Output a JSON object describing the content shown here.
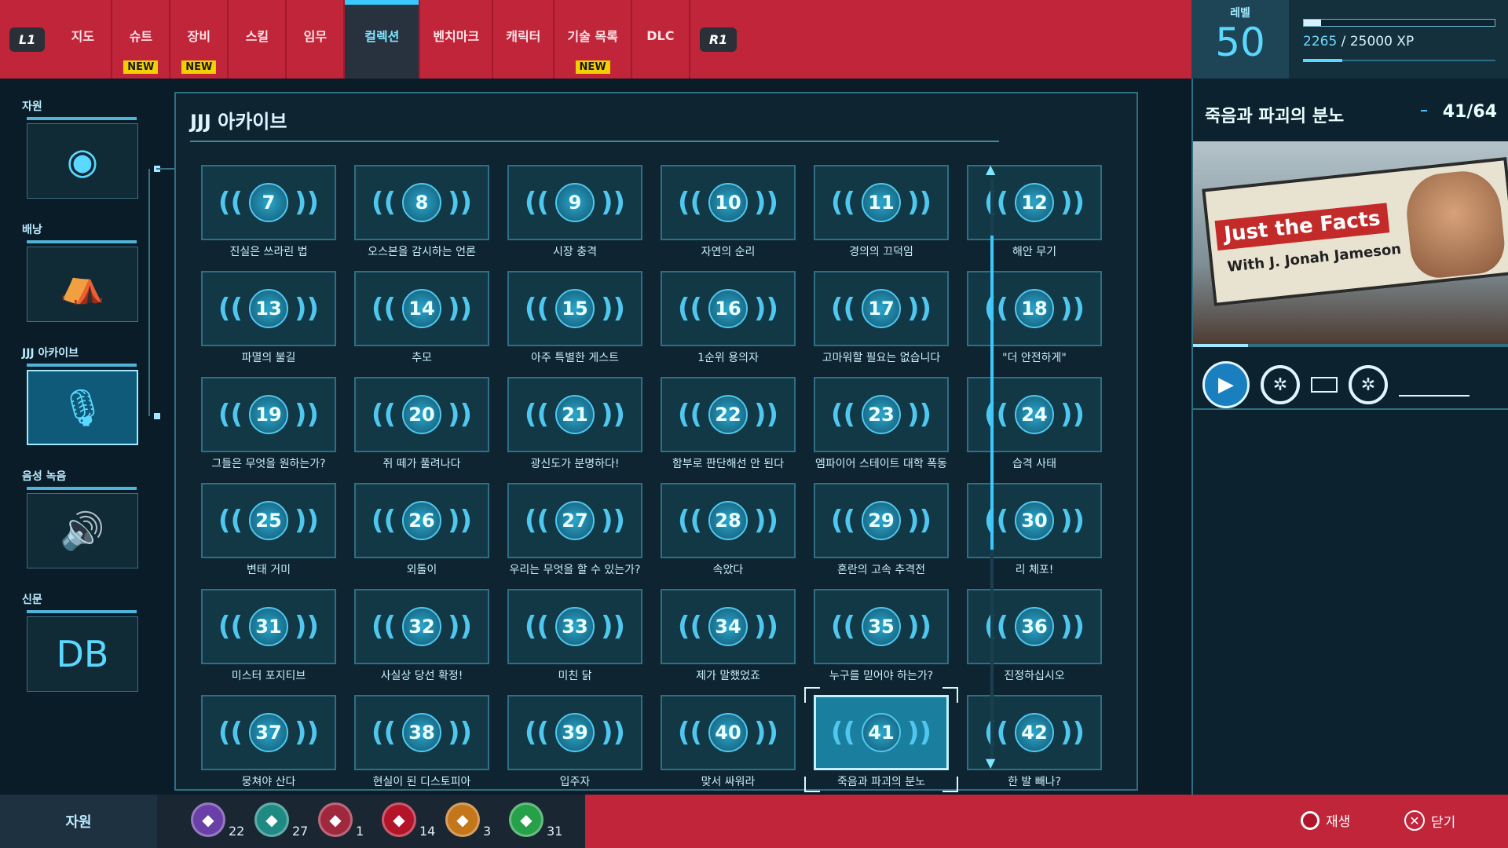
{
  "topbar": {
    "left_shoulder": "L1",
    "right_shoulder": "R1",
    "tabs": [
      {
        "label": "지도",
        "new": ""
      },
      {
        "label": "슈트",
        "new": "NEW"
      },
      {
        "label": "장비",
        "new": "NEW"
      },
      {
        "label": "스킬",
        "new": ""
      },
      {
        "label": "임무",
        "new": ""
      },
      {
        "label": "컬렉션",
        "new": "",
        "active": true
      },
      {
        "label": "벤치마크",
        "new": ""
      },
      {
        "label": "캐릭터",
        "new": ""
      },
      {
        "label": "기술 목록",
        "new": "NEW"
      },
      {
        "label": "DLC",
        "new": ""
      }
    ]
  },
  "level": {
    "label": "레벨",
    "value": "50",
    "xp_current": "2265",
    "xp_sep": " / ",
    "xp_total": "25000 XP",
    "xp_fraction": 0.0906
  },
  "sidebar": {
    "categories": [
      {
        "label": "자원",
        "icon": "coins-icon",
        "glyph": "◉"
      },
      {
        "label": "배낭",
        "icon": "backpack-icon",
        "glyph": "⛺"
      },
      {
        "label": "JJJ 아카이브",
        "icon": "microphone-icon",
        "glyph": "🎙",
        "active": true
      },
      {
        "label": "음성 녹음",
        "icon": "speaker-icon",
        "glyph": "🔊"
      },
      {
        "label": "신문",
        "icon": "daily-bugle-icon",
        "glyph": "DB"
      }
    ]
  },
  "main": {
    "title": "JJJ 아카이브",
    "items": [
      {
        "num": "7",
        "label": "진실은 쓰라린 법"
      },
      {
        "num": "8",
        "label": "오스본을 감시하는 언론"
      },
      {
        "num": "9",
        "label": "시장 충격"
      },
      {
        "num": "10",
        "label": "자연의 순리"
      },
      {
        "num": "11",
        "label": "경의의 끄덕임"
      },
      {
        "num": "12",
        "label": "해안 무기"
      },
      {
        "num": "13",
        "label": "파멸의 불길"
      },
      {
        "num": "14",
        "label": "추모"
      },
      {
        "num": "15",
        "label": "아주 특별한 게스트"
      },
      {
        "num": "16",
        "label": "1순위 용의자"
      },
      {
        "num": "17",
        "label": "고마워할 필요는 없습니다"
      },
      {
        "num": "18",
        "label": "\"더 안전하게\""
      },
      {
        "num": "19",
        "label": "그들은 무엇을 원하는가?"
      },
      {
        "num": "20",
        "label": "쥐 떼가 풀려나다"
      },
      {
        "num": "21",
        "label": "광신도가 분명하다!"
      },
      {
        "num": "22",
        "label": "함부로 판단해선 안 된다"
      },
      {
        "num": "23",
        "label": "엠파이어 스테이트 대학 폭동"
      },
      {
        "num": "24",
        "label": "습격 사태"
      },
      {
        "num": "25",
        "label": "변태 거미"
      },
      {
        "num": "26",
        "label": "외톨이"
      },
      {
        "num": "27",
        "label": "우리는 무엇을 할 수 있는가?"
      },
      {
        "num": "28",
        "label": "속았다"
      },
      {
        "num": "29",
        "label": "혼란의 고속 추격전"
      },
      {
        "num": "30",
        "label": "리 체포!"
      },
      {
        "num": "31",
        "label": "미스터 포지티브"
      },
      {
        "num": "32",
        "label": "사실상 당선 확정!"
      },
      {
        "num": "33",
        "label": "미친 닭"
      },
      {
        "num": "34",
        "label": "제가 말했었죠"
      },
      {
        "num": "35",
        "label": "누구를 믿어야 하는가?"
      },
      {
        "num": "36",
        "label": "진정하십시오"
      },
      {
        "num": "37",
        "label": "뭉쳐야 산다"
      },
      {
        "num": "38",
        "label": "현실이 된 디스토피아"
      },
      {
        "num": "39",
        "label": "입주자"
      },
      {
        "num": "40",
        "label": "맞서 싸워라"
      },
      {
        "num": "41",
        "label": "죽음과 파괴의 분노",
        "selected": true
      },
      {
        "num": "42",
        "label": "한 발 빼나?"
      }
    ]
  },
  "detail": {
    "title": "죽음과 파괴의 분노",
    "count": "41/64",
    "billboard_title": "Just the Facts",
    "billboard_sub": "With J. Jonah Jameson"
  },
  "bottombar": {
    "resources_label": "자원",
    "resources": [
      {
        "icon": "research-token-icon",
        "count": "22",
        "color": "#6a3fa8"
      },
      {
        "icon": "landmark-token-icon",
        "count": "27",
        "color": "#1f8a84"
      },
      {
        "icon": "backpack-token-icon",
        "count": "1",
        "color": "#a0283e"
      },
      {
        "icon": "crime-token-icon",
        "count": "14",
        "color": "#b3142a"
      },
      {
        "icon": "challenge-token-icon",
        "count": "3",
        "color": "#c4761a"
      },
      {
        "icon": "base-token-icon",
        "count": "31",
        "color": "#27a04a"
      }
    ],
    "play_label": "재생",
    "close_label": "닫기"
  }
}
